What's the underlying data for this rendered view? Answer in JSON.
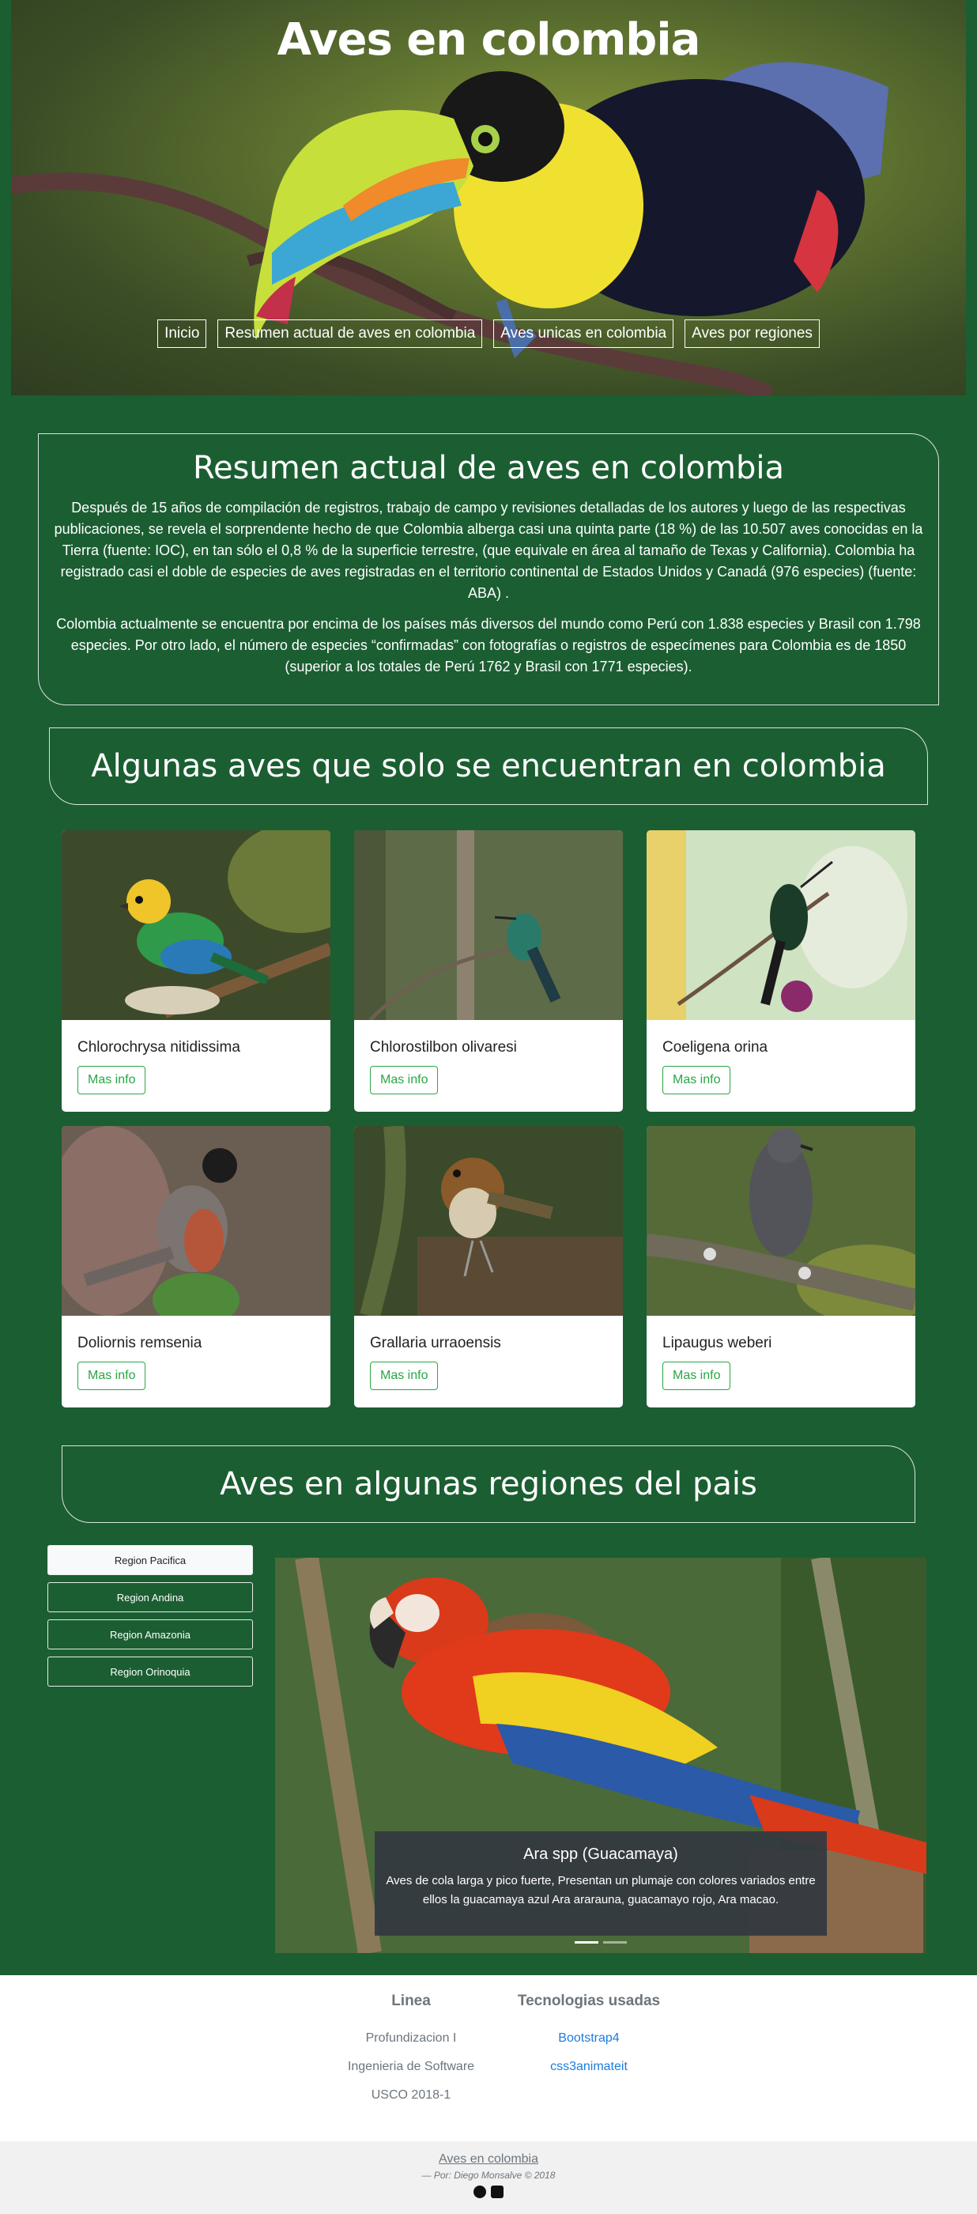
{
  "hero": {
    "title": "Aves en colombia",
    "nav": [
      "Inicio",
      "Resumen actual de aves en colombia",
      "Aves unicas en colombia",
      "Aves por regiones"
    ]
  },
  "summary": {
    "title": "Resumen actual de aves en colombia",
    "p1": "Después de 15 años de compilación de registros, trabajo de campo y revisiones detalladas de los autores y luego de las respectivas publicaciones, se revela el sorprendente hecho de que Colombia alberga casi una quinta parte (18 %) de las 10.507 aves conocidas en la Tierra (fuente: IOC), en tan sólo el 0,8 % de la superficie terrestre, (que equivale en área al tamaño de Texas y California). Colombia ha registrado casi el doble de especies de aves registradas en el territorio continental de Estados Unidos y Canadá (976 especies) (fuente: ABA) .",
    "p2": "Colombia actualmente se encuentra por encima de los países más diversos del mundo como Perú con 1.838 especies y Brasil con 1.798 especies. Por otro lado, el número de especies “confirmadas” con fotografías o registros de especímenes para Colombia es de 1850 (superior a los totales de Perú 1762 y Brasil con 1771 especies)."
  },
  "unique": {
    "title": "Algunas aves que solo se encuentran en colombia",
    "button_label": "Mas info",
    "cards": [
      {
        "name": "Chlorochrysa nitidissima"
      },
      {
        "name": "Chlorostilbon olivaresi"
      },
      {
        "name": "Coeligena orina"
      },
      {
        "name": "Doliornis remsenia"
      },
      {
        "name": "Grallaria urraoensis"
      },
      {
        "name": "Lipaugus weberi"
      }
    ]
  },
  "regions": {
    "title": "Aves en algunas regiones del pais",
    "buttons": [
      "Region Pacifica",
      "Region Andina",
      "Region Amazonia",
      "Region Orinoquia"
    ],
    "active": "Region Pacifica",
    "carousel": {
      "caption_title": "Ara spp (Guacamaya)",
      "caption_text": "Aves de cola larga y pico fuerte, Presentan un plumaje con colores variados entre ellos la guacamaya azul Ara ararauna, guacamayo rojo, Ara macao.",
      "slides": 2,
      "current": 1
    }
  },
  "footer": {
    "col1_title": "Linea",
    "col1_items": [
      "Profundizacion I",
      "Ingenieria de Software",
      "USCO 2018-1"
    ],
    "col2_title": "Tecnologias usadas",
    "col2_links": [
      "Bootstrap4",
      "css3animateit"
    ],
    "brand": "Aves en colombia",
    "by": "— Por: Diego Monsalve © 2018",
    "icons": [
      "github-icon",
      "facebook-icon"
    ]
  },
  "colors": {
    "background": "#1b5e32",
    "accent": "#28a745",
    "link": "#1d7ce0"
  }
}
